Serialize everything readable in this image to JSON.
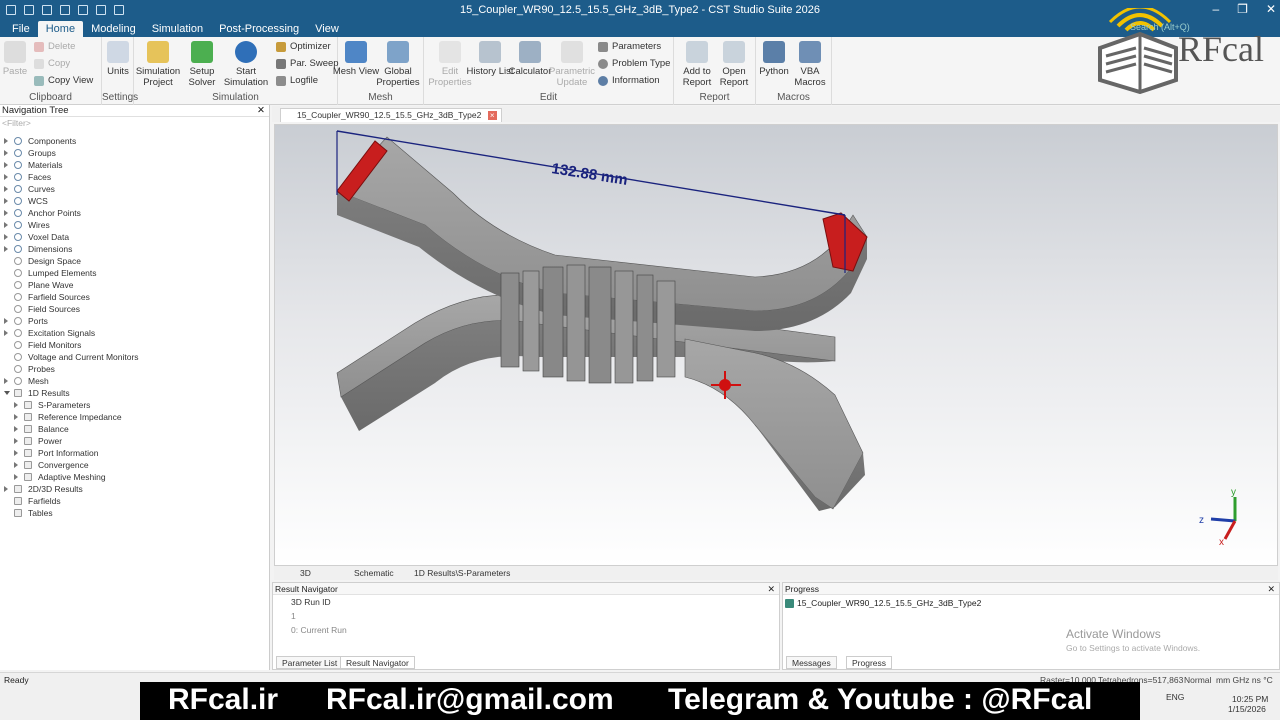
{
  "window": {
    "title": "15_Coupler_WR90_12.5_15.5_GHz_3dB_Type2 - CST Studio Suite 2026",
    "search_placeholder": "Search (Alt+Q)"
  },
  "menu": {
    "tabs": [
      "File",
      "Home",
      "Modeling",
      "Simulation",
      "Post-Processing",
      "View"
    ],
    "active": "Home"
  },
  "ribbon": {
    "clipboard": {
      "label": "Clipboard",
      "paste": "Paste",
      "delete": "Delete",
      "copy": "Copy",
      "copy_view": "Copy View"
    },
    "settings": {
      "label": "Settings",
      "units": "Units"
    },
    "simulation": {
      "label": "Simulation",
      "simulation_project": "Simulation Project",
      "setup_solver": "Setup Solver",
      "start_simulation": "Start Simulation",
      "optimizer": "Optimizer",
      "par_sweep": "Par. Sweep",
      "logfile": "Logfile"
    },
    "mesh": {
      "label": "Mesh",
      "mesh_view": "Mesh View",
      "global_properties": "Global Properties"
    },
    "edit": {
      "label": "Edit",
      "edit_properties": "Edit Properties",
      "history_list": "History List",
      "calculator": "Calculator",
      "parametric_update": "Parametric Update",
      "parameters": "Parameters",
      "problem_type": "Problem Type",
      "information": "Information"
    },
    "report": {
      "label": "Report",
      "add_to_report": "Add to Report",
      "open_report": "Open Report"
    },
    "macros": {
      "label": "Macros",
      "python": "Python",
      "vba_macros": "VBA Macros"
    }
  },
  "logo": {
    "text": "RFcal"
  },
  "navigation_tree": {
    "title": "Navigation Tree",
    "filter_placeholder": "<Filter>",
    "items": [
      {
        "label": "Components",
        "level": 0,
        "expander": "closed",
        "icon": "blue"
      },
      {
        "label": "Groups",
        "level": 0,
        "expander": "closed",
        "icon": "blue"
      },
      {
        "label": "Materials",
        "level": 0,
        "expander": "closed",
        "icon": "blue"
      },
      {
        "label": "Faces",
        "level": 0,
        "expander": "closed",
        "icon": "blue"
      },
      {
        "label": "Curves",
        "level": 0,
        "expander": "closed",
        "icon": "blue"
      },
      {
        "label": "WCS",
        "level": 0,
        "expander": "closed",
        "icon": "blue"
      },
      {
        "label": "Anchor Points",
        "level": 0,
        "expander": "closed",
        "icon": "blue"
      },
      {
        "label": "Wires",
        "level": 0,
        "expander": "closed",
        "icon": "blue"
      },
      {
        "label": "Voxel Data",
        "level": 0,
        "expander": "closed",
        "icon": "blue"
      },
      {
        "label": "Dimensions",
        "level": 0,
        "expander": "closed",
        "icon": "blue"
      },
      {
        "label": "Design Space",
        "level": 0,
        "expander": "none",
        "icon": "gray"
      },
      {
        "label": "Lumped Elements",
        "level": 0,
        "expander": "none",
        "icon": "gray"
      },
      {
        "label": "Plane Wave",
        "level": 0,
        "expander": "none",
        "icon": "gray"
      },
      {
        "label": "Farfield Sources",
        "level": 0,
        "expander": "none",
        "icon": "gray"
      },
      {
        "label": "Field Sources",
        "level": 0,
        "expander": "none",
        "icon": "gray"
      },
      {
        "label": "Ports",
        "level": 0,
        "expander": "closed",
        "icon": "gray"
      },
      {
        "label": "Excitation Signals",
        "level": 0,
        "expander": "closed",
        "icon": "gray"
      },
      {
        "label": "Field Monitors",
        "level": 0,
        "expander": "none",
        "icon": "gray"
      },
      {
        "label": "Voltage and Current Monitors",
        "level": 0,
        "expander": "none",
        "icon": "gray"
      },
      {
        "label": "Probes",
        "level": 0,
        "expander": "none",
        "icon": "gray"
      },
      {
        "label": "Mesh",
        "level": 0,
        "expander": "closed",
        "icon": "gray"
      },
      {
        "label": "1D Results",
        "level": 0,
        "expander": "open",
        "icon": "folder"
      },
      {
        "label": "S-Parameters",
        "level": 1,
        "expander": "closed",
        "icon": "folder"
      },
      {
        "label": "Reference Impedance",
        "level": 1,
        "expander": "closed",
        "icon": "folder"
      },
      {
        "label": "Balance",
        "level": 1,
        "expander": "closed",
        "icon": "folder"
      },
      {
        "label": "Power",
        "level": 1,
        "expander": "closed",
        "icon": "folder"
      },
      {
        "label": "Port Information",
        "level": 1,
        "expander": "closed",
        "icon": "folder"
      },
      {
        "label": "Convergence",
        "level": 1,
        "expander": "closed",
        "icon": "folder"
      },
      {
        "label": "Adaptive Meshing",
        "level": 1,
        "expander": "closed",
        "icon": "folder"
      },
      {
        "label": "2D/3D Results",
        "level": 0,
        "expander": "closed",
        "icon": "folder"
      },
      {
        "label": "Farfields",
        "level": 0,
        "expander": "none",
        "icon": "folder"
      },
      {
        "label": "Tables",
        "level": 0,
        "expander": "none",
        "icon": "folder"
      }
    ]
  },
  "document_tab": {
    "label": "15_Coupler_WR90_12.5_15.5_GHz_3dB_Type2",
    "close": "×"
  },
  "viewport": {
    "dimension_label": "132.88 mm",
    "axes": {
      "x": "x",
      "y": "y",
      "z": "z"
    }
  },
  "view_tabs": [
    "3D",
    "Schematic",
    "1D Results\\S-Parameters"
  ],
  "result_navigator": {
    "title": "Result Navigator",
    "rows": [
      "3D Run ID",
      "1",
      "0: Current Run"
    ]
  },
  "progress": {
    "title": "Progress",
    "item": "15_Coupler_WR90_12.5_15.5_GHz_3dB_Type2"
  },
  "activate_windows": {
    "title": "Activate Windows",
    "subtitle": "Go to Settings to activate Windows."
  },
  "panel_tabs": {
    "left": [
      "Parameter List",
      "Result Navigator"
    ],
    "right": [
      "Messages",
      "Progress"
    ]
  },
  "statusbar": {
    "ready": "Ready",
    "raster": "Raster=10.000",
    "tetrahedrons": "Tetrahedrons=517,863",
    "mode": "Normal",
    "units": "mm GHz ns °C"
  },
  "taskbar": {
    "lang": "ENG",
    "time": "10:25 PM",
    "date": "1/15/2026"
  },
  "banner": {
    "site": "RFcal.ir",
    "email": "RFcal.ir@gmail.com",
    "social": "Telegram & Youtube : @RFcal"
  },
  "colors": {
    "titlebar": "#1d5c8a",
    "port": "#c81e1e",
    "dimension": "#1a237e",
    "model": "#8f8f8f"
  }
}
